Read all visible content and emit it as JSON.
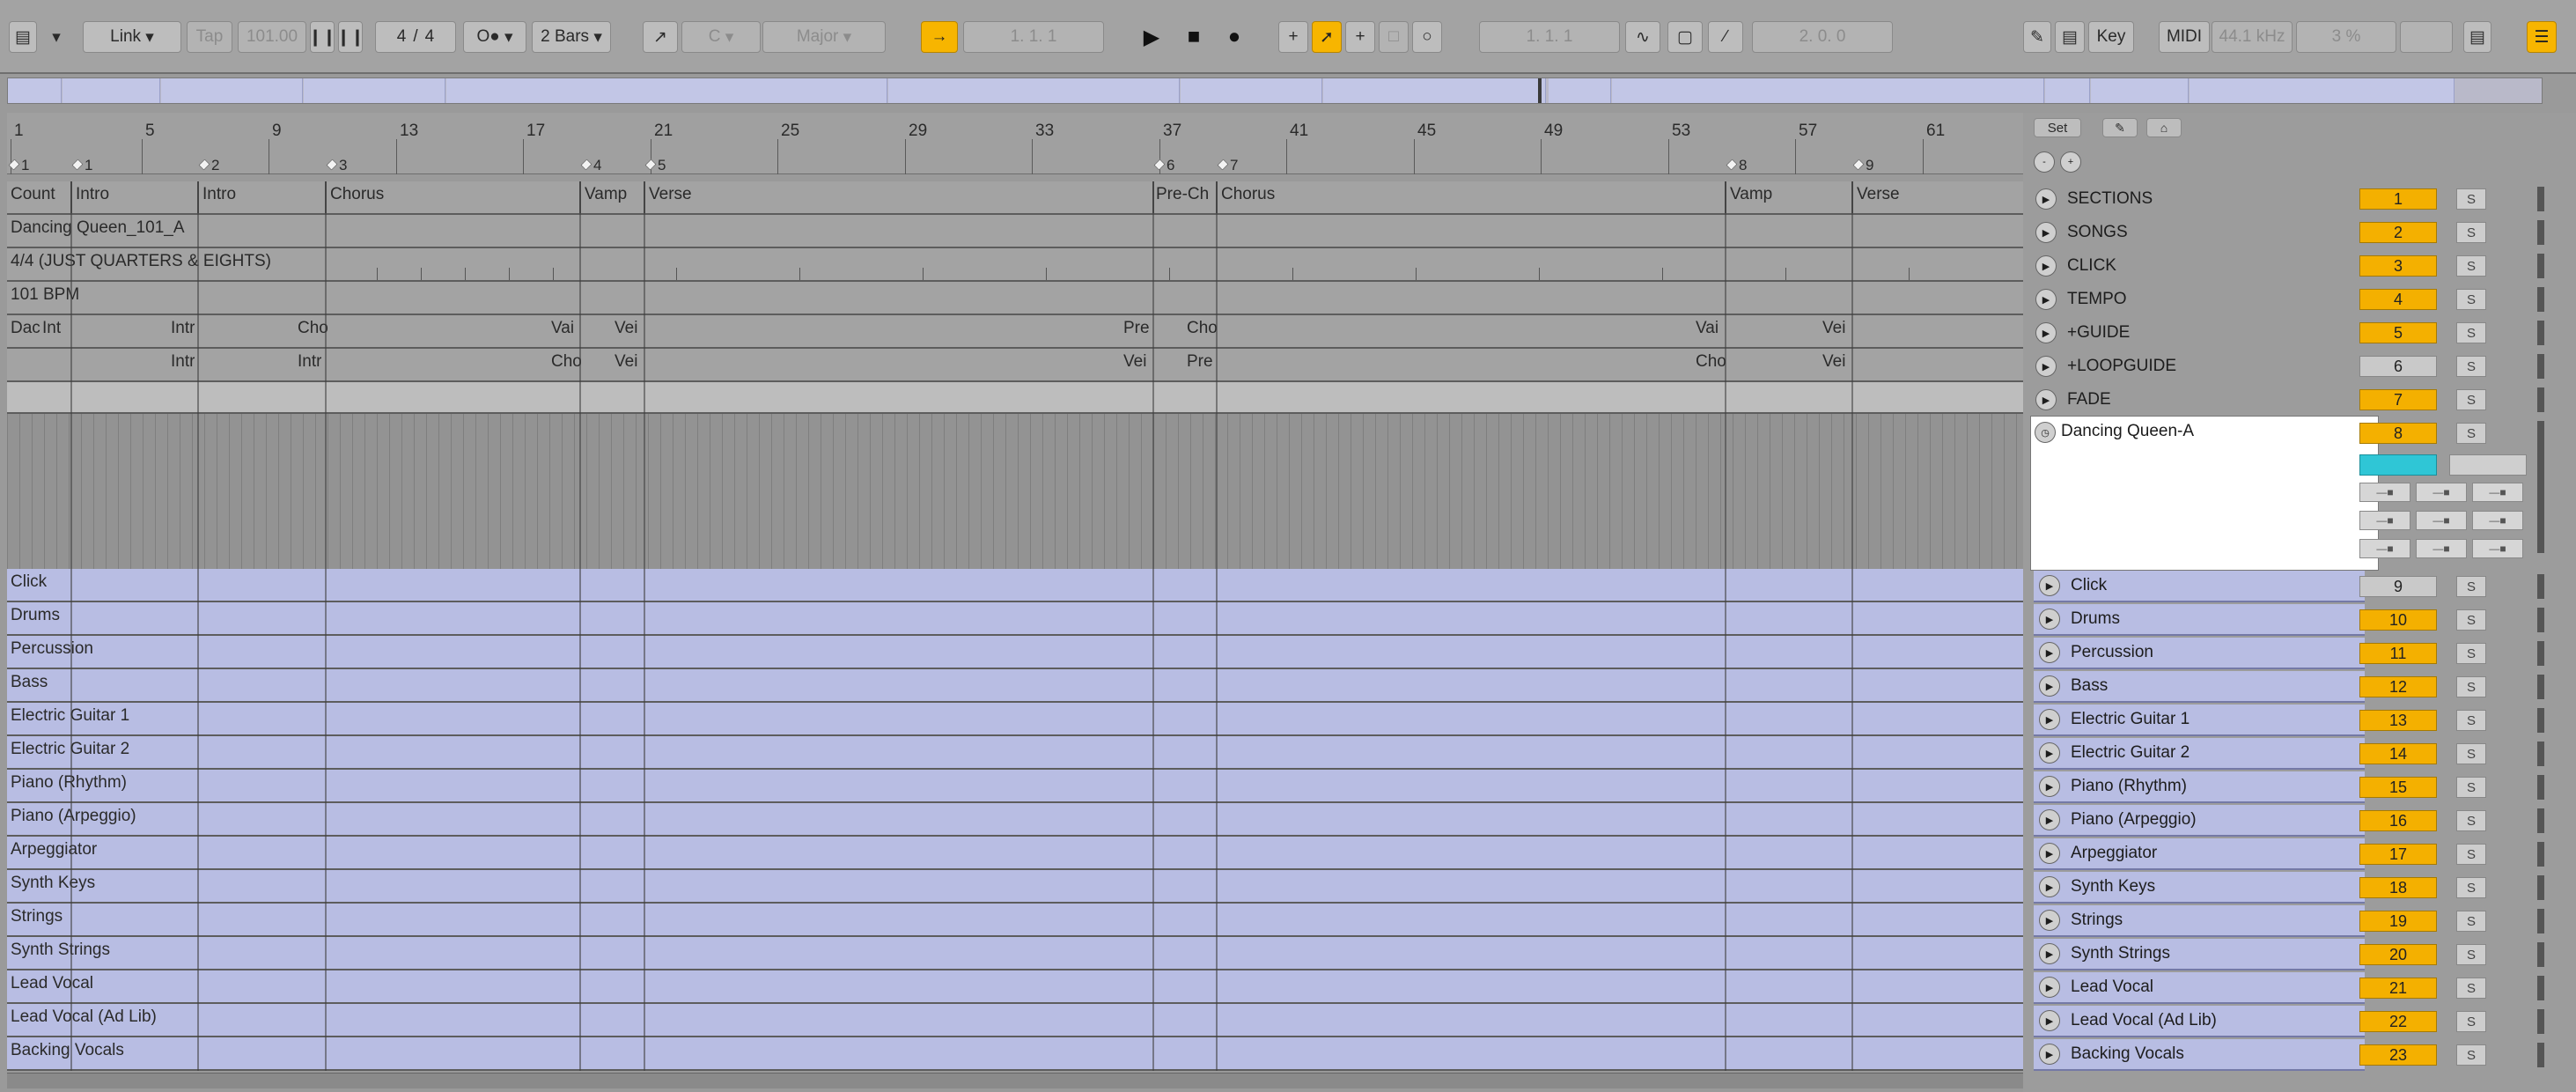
{
  "toolbar": {
    "link": "Link",
    "tap": "Tap",
    "tempo": "101.00",
    "sig_num": "4",
    "sig_den": "4",
    "metronome": "O●",
    "quantize": "2 Bars",
    "key_root": "C",
    "scale": "Major",
    "position": "1.   1.   1",
    "loop_start": "1.   1.   1",
    "loop_length": "2.   0.   0",
    "key_btn": "Key",
    "midi_btn": "MIDI",
    "sample_rate": "44.1 kHz",
    "cpu": "3 %",
    "icons": [
      "view-icon",
      "dropdown-icon",
      "play-icon",
      "stop-icon",
      "record-icon",
      "follow-icon",
      "draw-icon",
      "menu-icon"
    ]
  },
  "ruler": {
    "bars": [
      "1",
      "5",
      "9",
      "13",
      "17",
      "21",
      "25",
      "29",
      "33",
      "37",
      "41",
      "45",
      "49",
      "53",
      "57",
      "61"
    ],
    "locators": [
      "1",
      "1",
      "2",
      "3",
      "4",
      "5",
      "6",
      "7",
      "8",
      "9"
    ]
  },
  "arrangement": {
    "sections": [
      "Count",
      "Intro",
      "Intro",
      "Chorus",
      "Vamp",
      "Verse",
      "Pre-Ch",
      "Chorus",
      "Vamp",
      "Verse"
    ],
    "song": "Dancing Queen_101_A",
    "click_info": "4/4 (JUST QUARTERS & EIGHTS)",
    "tempo_info": "101 BPM",
    "guide_clips": [
      "Dac",
      "Int",
      "Intr",
      "Cho",
      "Vai",
      "Vei",
      "Pre",
      "Cho",
      "Vai",
      "Vei"
    ],
    "loopguide_clips": [
      "Intr",
      "Intr",
      "Cho",
      "Vei",
      "Vei",
      "Pre",
      "Cho",
      "Vei"
    ],
    "blue_tracks": [
      "Click",
      "Drums",
      "Percussion",
      "Bass",
      "Electric Guitar 1",
      "Electric Guitar 2",
      "Piano (Rhythm)",
      "Piano (Arpeggio)",
      "Arpeggiator",
      "Synth Keys",
      "Strings",
      "Synth Strings",
      "Lead Vocal",
      "Lead Vocal (Ad Lib)",
      "Backing Vocals"
    ]
  },
  "right_panel": {
    "set_btn": "Set",
    "gray_tracks": [
      {
        "name": "SECTIONS",
        "num": "1"
      },
      {
        "name": "SONGS",
        "num": "2"
      },
      {
        "name": "CLICK",
        "num": "3"
      },
      {
        "name": "TEMPO",
        "num": "4"
      },
      {
        "name": "+GUIDE",
        "num": "5"
      },
      {
        "name": "+LOOPGUIDE",
        "num": "6"
      },
      {
        "name": "FADE",
        "num": "7"
      }
    ],
    "selected_clip": "Dancing Queen-A",
    "selected_num": "8",
    "blue_tracks": [
      {
        "name": "Click",
        "num": "9"
      },
      {
        "name": "Drums",
        "num": "10"
      },
      {
        "name": "Percussion",
        "num": "11"
      },
      {
        "name": "Bass",
        "num": "12"
      },
      {
        "name": "Electric Guitar 1",
        "num": "13"
      },
      {
        "name": "Electric Guitar 2",
        "num": "14"
      },
      {
        "name": "Piano (Rhythm)",
        "num": "15"
      },
      {
        "name": "Piano (Arpeggio)",
        "num": "16"
      },
      {
        "name": "Arpeggiator",
        "num": "17"
      },
      {
        "name": "Synth Keys",
        "num": "18"
      },
      {
        "name": "Strings",
        "num": "19"
      },
      {
        "name": "Synth Strings",
        "num": "20"
      },
      {
        "name": "Lead Vocal",
        "num": "21"
      },
      {
        "name": "Lead Vocal (Ad Lib)",
        "num": "22"
      },
      {
        "name": "Backing Vocals",
        "num": "23"
      }
    ],
    "solo_label": "S"
  },
  "colors": {
    "accent": "#f7b500",
    "clip_blue": "#b8bde3",
    "panel": "#a3a3a3"
  }
}
